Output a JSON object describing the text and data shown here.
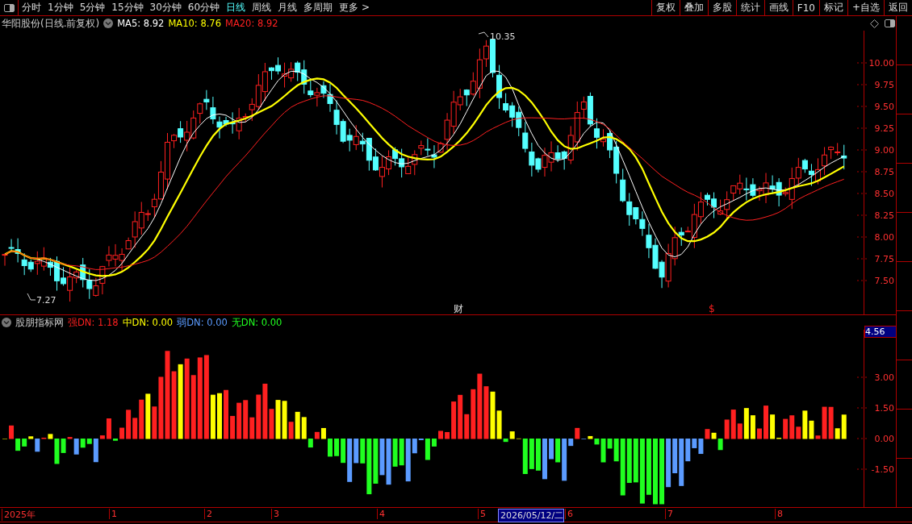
{
  "toolbar": {
    "periods": [
      {
        "label": "分时",
        "selected": false
      },
      {
        "label": "1分钟",
        "selected": false
      },
      {
        "label": "5分钟",
        "selected": false
      },
      {
        "label": "15分钟",
        "selected": false
      },
      {
        "label": "30分钟",
        "selected": false
      },
      {
        "label": "60分钟",
        "selected": false
      },
      {
        "label": "日线",
        "selected": true
      },
      {
        "label": "周线",
        "selected": false
      },
      {
        "label": "月线",
        "selected": false
      },
      {
        "label": "多周期",
        "selected": false
      },
      {
        "label": "更多 >",
        "selected": false
      }
    ],
    "actions": [
      "复权",
      "叠加",
      "多股",
      "统计",
      "画线",
      "F10",
      "标记",
      "+自选",
      "返回"
    ]
  },
  "price_panel": {
    "title": "华阳股份(日线.前复权)",
    "indicators": [
      {
        "label": "MA5: 8.92",
        "color": "#ffffff"
      },
      {
        "label": "MA10: 8.76",
        "color": "#ffff00"
      },
      {
        "label": "MA20: 8.92",
        "color": "#ff2020"
      }
    ],
    "high_label": "10.35",
    "low_label": "7.27",
    "axis_labels": [
      "10.00",
      "9.75",
      "9.50",
      "9.25",
      "9.00",
      "8.75",
      "8.50",
      "8.25",
      "8.00",
      "7.75",
      "7.50"
    ],
    "event_markers": [
      {
        "label": "财",
        "kind": "finance"
      },
      {
        "label": "$",
        "kind": "dividend"
      }
    ]
  },
  "indicator_panel": {
    "title": "股朋指标网",
    "values": [
      {
        "label": "强DN: 1.18",
        "color": "#ff2020"
      },
      {
        "label": "中DN: 0.00",
        "color": "#ffff00"
      },
      {
        "label": "弱DN: 0.00",
        "color": "#5b9bff"
      },
      {
        "label": "无DN: 0.00",
        "color": "#20ff20"
      }
    ],
    "current_value": "4.56",
    "axis_labels": [
      "3.00",
      "1.50",
      "0.00",
      "-1.50"
    ]
  },
  "date_axis": {
    "labels": [
      {
        "label": "2025年",
        "selected": false
      },
      {
        "label": "1",
        "selected": false
      },
      {
        "label": "2",
        "selected": false
      },
      {
        "label": "3",
        "selected": false
      },
      {
        "label": "4",
        "selected": false
      },
      {
        "label": "5",
        "selected": false
      },
      {
        "label": "2026/05/12/二",
        "selected": true
      },
      {
        "label": "6",
        "selected": false
      },
      {
        "label": "7",
        "selected": false
      },
      {
        "label": "8",
        "selected": false
      }
    ]
  }
}
